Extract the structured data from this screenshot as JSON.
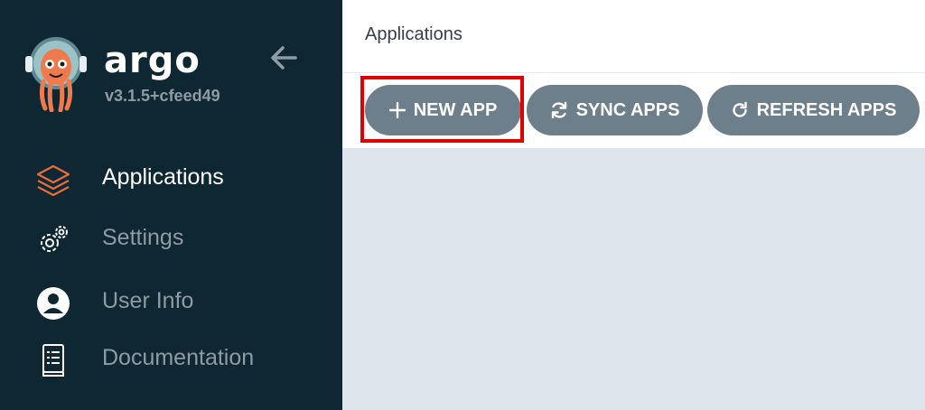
{
  "brand": {
    "name": "argo",
    "version": "v3.1.5+cfeed49"
  },
  "sidebar": {
    "items": [
      {
        "label": "Applications",
        "icon": "layers-icon",
        "active": true
      },
      {
        "label": "Settings",
        "icon": "gears-icon",
        "active": false
      },
      {
        "label": "User Info",
        "icon": "user-circle-icon",
        "active": false
      },
      {
        "label": "Documentation",
        "icon": "book-icon",
        "active": false
      }
    ]
  },
  "header": {
    "title": "Applications"
  },
  "toolbar": {
    "new_app_label": "NEW APP",
    "sync_apps_label": "SYNC APPS",
    "refresh_apps_label": "REFRESH APPS"
  },
  "colors": {
    "sidebar_bg": "#0f2733",
    "accent_orange": "#e96d3c",
    "button_bg": "#6d7f8b",
    "content_bg": "#dee5ec",
    "highlight": "#e00000"
  }
}
